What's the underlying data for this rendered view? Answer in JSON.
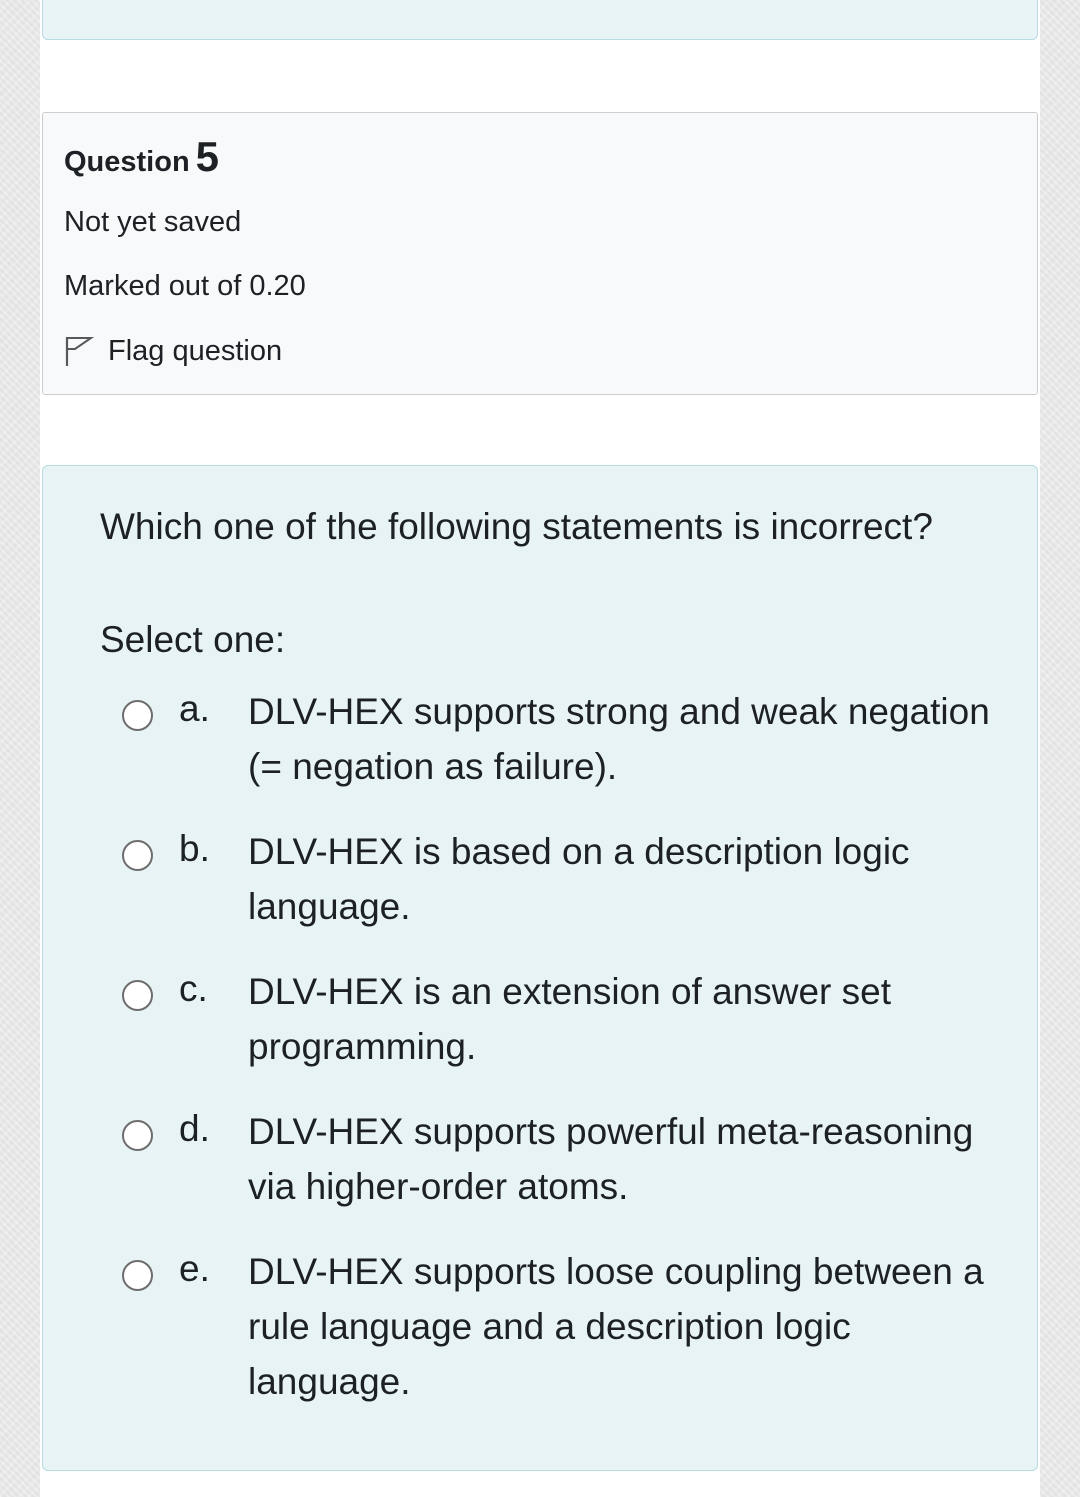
{
  "question": {
    "label": "Question",
    "number": "5",
    "state": "Not yet saved",
    "grade": "Marked out of 0.20",
    "flag_label": "Flag question",
    "flag_icon": "flag-outline-icon"
  },
  "formulation": {
    "text": "Which one of the following statements is incorrect?",
    "prompt": "Select one:",
    "options": [
      {
        "letter": "a.",
        "text": "DLV-HEX supports strong and weak negation (= negation as failure).",
        "selected": false
      },
      {
        "letter": "b.",
        "text": "DLV-HEX is based on a description logic language.",
        "selected": false
      },
      {
        "letter": "c.",
        "text": "DLV-HEX is an extension of answer set programming.",
        "selected": false
      },
      {
        "letter": "d.",
        "text": "DLV-HEX supports powerful meta-reasoning via higher-order atoms.",
        "selected": false
      },
      {
        "letter": "e.",
        "text": "DLV-HEX supports loose coupling between a rule language and a description logic language.",
        "selected": false
      }
    ]
  },
  "colors": {
    "formulation_bg": "#e7f3f5",
    "formulation_border": "#b8dce2",
    "info_bg": "#f8f9fa",
    "text": "#1d2125",
    "radio_border": "#6d6d6d"
  }
}
